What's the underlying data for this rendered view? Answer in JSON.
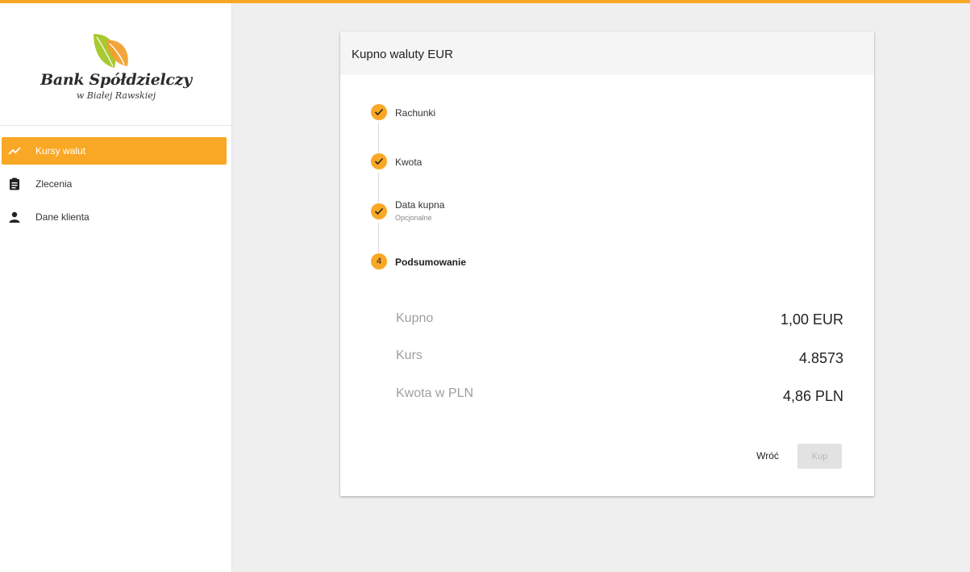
{
  "logo": {
    "name": "Bank Spółdzielczy",
    "subtitle": "w Białej Rawskiej"
  },
  "sidebar": {
    "items": [
      {
        "label": "Kursy walut",
        "icon": "trending-up-icon",
        "active": true
      },
      {
        "label": "Zlecenia",
        "icon": "clipboard-icon",
        "active": false
      },
      {
        "label": "Dane klienta",
        "icon": "person-icon",
        "active": false
      }
    ]
  },
  "card": {
    "title": "Kupno waluty EUR",
    "steps": [
      {
        "label": "Rachunki",
        "state": "done"
      },
      {
        "label": "Kwota",
        "state": "done"
      },
      {
        "label": "Data kupna",
        "sublabel": "Opcjonalne",
        "state": "done"
      },
      {
        "label": "Podsumowanie",
        "number": "4",
        "state": "active"
      }
    ],
    "summary": [
      {
        "label": "Kupno",
        "value": "1,00 EUR"
      },
      {
        "label": "Kurs",
        "value": "4.8573"
      },
      {
        "label": "Kwota w PLN",
        "value": "4,86 PLN"
      }
    ],
    "buttons": {
      "back": "Wróć",
      "buy": "Kup"
    }
  },
  "colors": {
    "accent": "#f9a825",
    "logo_leaf_green": "#a8c932",
    "logo_leaf_orange": "#f0a030"
  }
}
